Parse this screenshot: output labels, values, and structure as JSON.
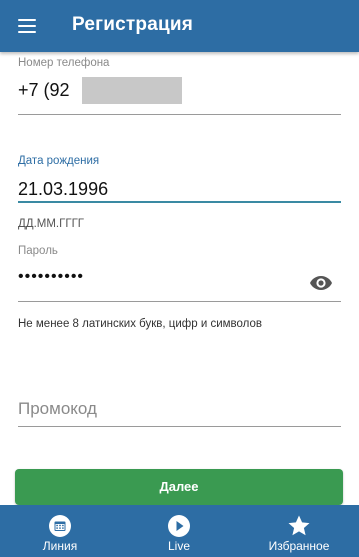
{
  "header": {
    "title": "Регистрация"
  },
  "form": {
    "phone": {
      "label": "Номер телефона",
      "value": "+7 (92"
    },
    "birthdate": {
      "label": "Дата рождения",
      "value": "21.03.1996",
      "helper": "ДД.ММ.ГГГГ"
    },
    "password": {
      "label": "Пароль",
      "value": "••••••••••",
      "helper": "Не менее 8 латинских букв, цифр и символов"
    },
    "promo": {
      "placeholder": "Промокод",
      "value": ""
    }
  },
  "actions": {
    "next_label": "Далее",
    "next_color": "#3a9a51"
  },
  "bottom_nav": {
    "items": [
      {
        "label": "Линия",
        "icon": "calendar-icon"
      },
      {
        "label": "Live",
        "icon": "play-icon"
      },
      {
        "label": "Избранное",
        "icon": "star-icon"
      }
    ]
  },
  "colors": {
    "primary": "#2d6da4",
    "accent_underline": "#3a8aa3",
    "button": "#3a9a51"
  }
}
